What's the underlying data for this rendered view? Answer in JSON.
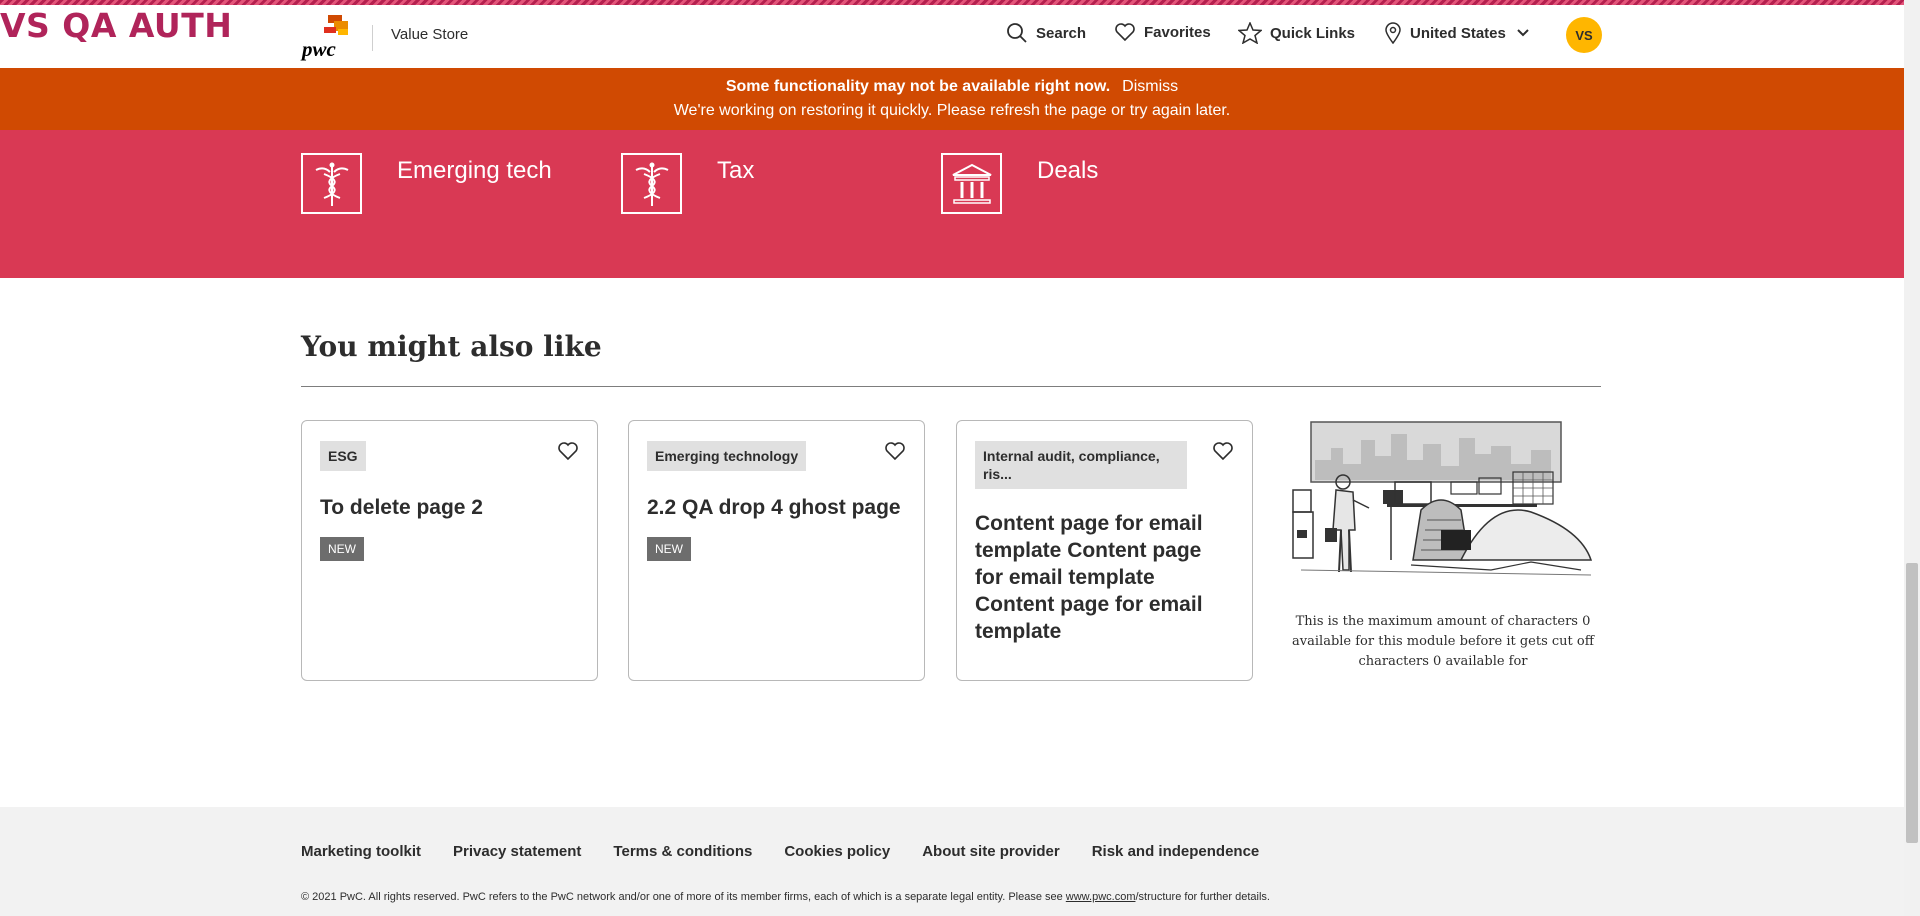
{
  "env_label": "VS QA AUTH",
  "header": {
    "brand": "pwc",
    "site_name": "Value Store",
    "nav": {
      "search": "Search",
      "favorites": "Favorites",
      "quick_links": "Quick Links",
      "region": "United States"
    },
    "avatar_initials": "VS"
  },
  "alert": {
    "headline": "Some functionality may not be available right now.",
    "dismiss": "Dismiss",
    "message": "We're working on restoring it quickly. Please refresh the page or try again later."
  },
  "topics": [
    {
      "label": "Emerging tech",
      "icon": "caduceus-icon"
    },
    {
      "label": "Tax",
      "icon": "caduceus-icon"
    },
    {
      "label": "Deals",
      "icon": "bank-icon"
    }
  ],
  "related": {
    "title": "You might also like",
    "cards": [
      {
        "tag": "ESG",
        "title": "To delete page 2",
        "badge": "NEW"
      },
      {
        "tag": "Emerging technology",
        "title": "2.2 QA drop 4 ghost page",
        "badge": "NEW"
      },
      {
        "tag": "Internal audit, compliance, ris...",
        "title": "Content page for email template Content page for email template Content page for email template",
        "badge": ""
      }
    ],
    "cartoon_caption": "This is the maximum amount of characters 0 available for this module before it gets cut off characters 0 available for"
  },
  "footer": {
    "links": [
      "Marketing toolkit",
      "Privacy statement",
      "Terms & conditions",
      "Cookies policy",
      "About site provider",
      "Risk and independence"
    ],
    "copyright_pre": "© 2021 PwC. All rights reserved. PwC refers to the PwC network and/or one of more of its member firms, each of which is a separate legal entity. Please see ",
    "copyright_link": "www.pwc.com",
    "copyright_post": "/structure for further details."
  },
  "colors": {
    "accent_orange": "#d04a02",
    "band_pink": "#d93954",
    "avatar_yellow": "#ffb600",
    "env_label": "#b0245a"
  }
}
